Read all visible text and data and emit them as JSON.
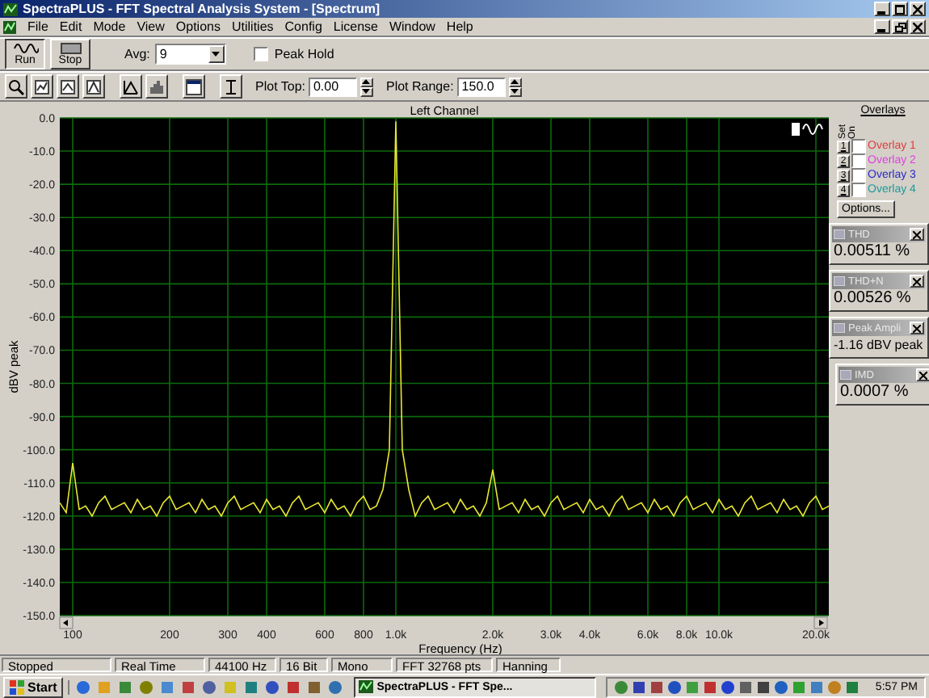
{
  "window": {
    "title": "SpectraPLUS - FFT Spectral Analysis System - [Spectrum]"
  },
  "menu": [
    "File",
    "Edit",
    "Mode",
    "View",
    "Options",
    "Utilities",
    "Config",
    "License",
    "Window",
    "Help"
  ],
  "toolbar": {
    "run_label": "Run",
    "stop_label": "Stop",
    "avg_label": "Avg:",
    "avg_value": "9",
    "peak_hold": {
      "label": "Peak Hold",
      "checked": false
    },
    "plot_top": {
      "label": "Plot Top:",
      "value": "0.00"
    },
    "plot_range": {
      "label": "Plot Range:",
      "value": "150.0"
    }
  },
  "chart": {
    "chart_data": {
      "type": "line",
      "title": "Left Channel",
      "xlabel": "Frequency (Hz)",
      "ylabel": "dBV peak",
      "ylim": [
        -150,
        0
      ],
      "grid": true,
      "categories": [
        null,
        null,
        "100",
        null,
        null,
        null,
        null,
        null,
        null,
        null,
        null,
        null,
        null,
        null,
        null,
        null,
        null,
        "200",
        null,
        null,
        null,
        null,
        null,
        null,
        null,
        null,
        "300",
        null,
        null,
        null,
        null,
        null,
        "400",
        null,
        null,
        null,
        null,
        null,
        null,
        null,
        null,
        "600",
        null,
        null,
        null,
        null,
        null,
        "800",
        null,
        null,
        null,
        null,
        "1.0k",
        null,
        null,
        null,
        null,
        null,
        null,
        null,
        null,
        null,
        null,
        null,
        null,
        null,
        null,
        "2.0k",
        null,
        null,
        null,
        null,
        null,
        null,
        null,
        null,
        "3.0k",
        null,
        null,
        null,
        null,
        null,
        "4.0k",
        null,
        null,
        null,
        null,
        null,
        null,
        null,
        null,
        "6.0k",
        null,
        null,
        null,
        null,
        null,
        "8.0k",
        null,
        null,
        null,
        null,
        "10.0k",
        null,
        null,
        null,
        null,
        null,
        null,
        null,
        null,
        null,
        null,
        null,
        null,
        null,
        null,
        "20.0k",
        null,
        null
      ],
      "yticks": [
        {
          "value": 0,
          "label": "0.0"
        },
        {
          "value": -10,
          "label": "-10.0"
        },
        {
          "value": -20,
          "label": "-20.0"
        },
        {
          "value": -30,
          "label": "-30.0"
        },
        {
          "value": -40,
          "label": "-40.0"
        },
        {
          "value": -50,
          "label": "-50.0"
        },
        {
          "value": -60,
          "label": "-60.0"
        },
        {
          "value": -70,
          "label": "-70.0"
        },
        {
          "value": -80,
          "label": "-80.0"
        },
        {
          "value": -90,
          "label": "-90.0"
        },
        {
          "value": -100,
          "label": "-100.0"
        },
        {
          "value": -110,
          "label": "-110.0"
        },
        {
          "value": -120,
          "label": "-120.0"
        },
        {
          "value": -130,
          "label": "-130.0"
        },
        {
          "value": -140,
          "label": "-140.0"
        },
        {
          "value": -150,
          "label": "-150.0"
        }
      ],
      "series": [
        {
          "color": "#e8e830",
          "values": [
            -116,
            -119,
            -104,
            -118,
            -117,
            -120,
            -116,
            -114,
            -118,
            -117,
            -116,
            -119,
            -115,
            -118,
            -117,
            -120,
            -116,
            -114,
            -118,
            -117,
            -116,
            -119,
            -115,
            -118,
            -117,
            -120,
            -116,
            -114,
            -118,
            -117,
            -116,
            -119,
            -115,
            -118,
            -117,
            -120,
            -116,
            -114,
            -118,
            -117,
            -116,
            -119,
            -115,
            -118,
            -117,
            -120,
            -116,
            -114,
            -118,
            -117,
            -112,
            -100,
            -1,
            -100,
            -112,
            -120,
            -116,
            -114,
            -118,
            -117,
            -116,
            -119,
            -115,
            -118,
            -117,
            -120,
            -116,
            -106,
            -118,
            -117,
            -116,
            -119,
            -115,
            -118,
            -117,
            -120,
            -116,
            -114,
            -118,
            -117,
            -116,
            -119,
            -115,
            -118,
            -117,
            -120,
            -116,
            -114,
            -118,
            -117,
            -116,
            -119,
            -115,
            -118,
            -117,
            -120,
            -116,
            -114,
            -118,
            -117,
            -116,
            -119,
            -115,
            -118,
            -117,
            -120,
            -116,
            -114,
            -118,
            -117,
            -116,
            -119,
            -115,
            -118,
            -117,
            -120,
            -116,
            -114,
            -118,
            -117
          ]
        }
      ]
    }
  },
  "overlays": {
    "title": "Overlays",
    "set_label": "Set",
    "on_label": "On",
    "items": [
      {
        "number": "1",
        "label": "Overlay 1",
        "checked": false,
        "color": "#e03c3c"
      },
      {
        "number": "2",
        "label": "Overlay 2",
        "checked": false,
        "color": "#e040e0"
      },
      {
        "number": "3",
        "label": "Overlay 3",
        "checked": false,
        "color": "#2828c8"
      },
      {
        "number": "4",
        "label": "Overlay 4",
        "checked": false,
        "color": "#1a9a9a"
      }
    ],
    "options_label": "Options..."
  },
  "meters": [
    {
      "title": "THD",
      "value": "0.00511 %"
    },
    {
      "title": "THD+N",
      "value": "0.00526 %"
    },
    {
      "title": "Peak Ampli",
      "value": "-1.16 dBV peak"
    },
    {
      "title": "IMD",
      "value": "0.0007 %"
    }
  ],
  "status_bar": [
    "Stopped",
    "Real Time",
    "44100 Hz",
    "16 Bit",
    "Mono",
    "FFT 32768 pts",
    "Hanning"
  ],
  "taskbar": {
    "start": "Start",
    "task": "SpectraPLUS - FFT Spe...",
    "clock": "5:57 PM"
  }
}
